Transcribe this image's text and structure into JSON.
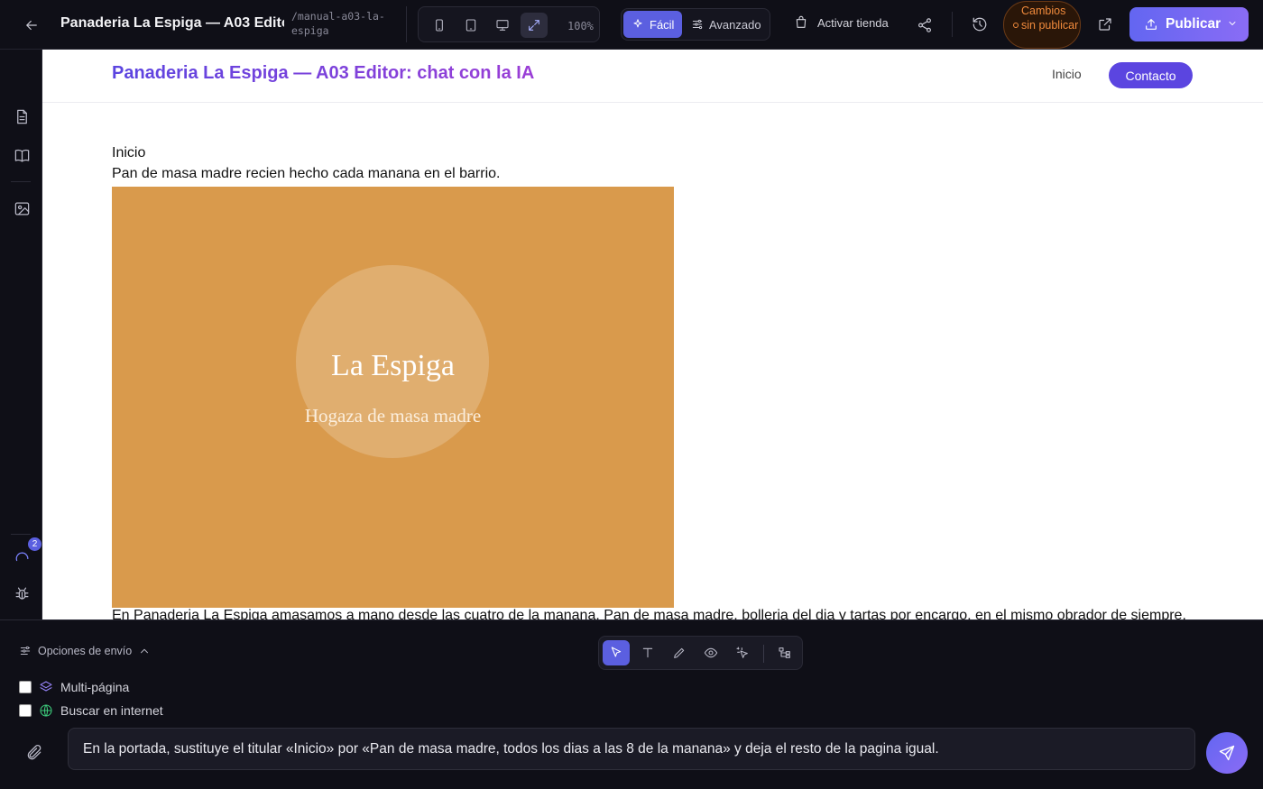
{
  "app": {
    "title": "Panaderia La Espiga — A03 Edito...",
    "slug": "/manual-a03-la-espiga",
    "zoom": "100%",
    "modes": {
      "easy": "Fácil",
      "advanced": "Avanzado"
    },
    "activate_store": "Activar tienda",
    "unsaved_status": "Cambios sin publicar",
    "publish": "Publicar",
    "tasks_badge": "2"
  },
  "site": {
    "title": "Panaderia La Espiga — A03 Editor: chat con la IA",
    "nav": {
      "home": "Inicio",
      "contact": "Contacto"
    },
    "hero": {
      "heading": "Inicio",
      "subheading": "Pan de masa madre recien hecho cada manana en el barrio.",
      "image_title": "La Espiga",
      "image_subtitle": "Hogaza de masa madre",
      "image_color": "#d99a4c"
    },
    "body": "En Panaderia La Espiga amasamos a mano desde las cuatro de la manana. Pan de masa madre, bolleria del dia y tartas por encargo, en el mismo obrador de siempre."
  },
  "composer": {
    "send_options": "Opciones de envío",
    "multipage": "Multi-página",
    "web_search": "Buscar en internet",
    "message": "En la portada, sustituye el titular «Inicio» por «Pan de masa madre, todos los dias a las 8 de la manana» y deja el resto de la pagina igual."
  },
  "colors": {
    "accent": "#5b5fe0",
    "brand_gradient_end": "#8a6cf5",
    "warning": "#f08a3c"
  },
  "icons": [
    "back-arrow-icon",
    "phone-icon",
    "tablet-icon",
    "desktop-icon",
    "expand-icon",
    "sparkle-icon",
    "sliders-icon",
    "shopping-bag-icon",
    "share-icon",
    "history-icon",
    "external-link-icon",
    "upload-icon",
    "chevron-down-icon",
    "document-icon",
    "book-icon",
    "image-icon",
    "spinner-icon",
    "bug-icon",
    "cursor-icon",
    "text-icon",
    "pencil-icon",
    "eye-icon",
    "magic-pointer-icon",
    "tree-icon",
    "paperclip-icon",
    "send-icon",
    "layers-icon",
    "globe-icon"
  ]
}
